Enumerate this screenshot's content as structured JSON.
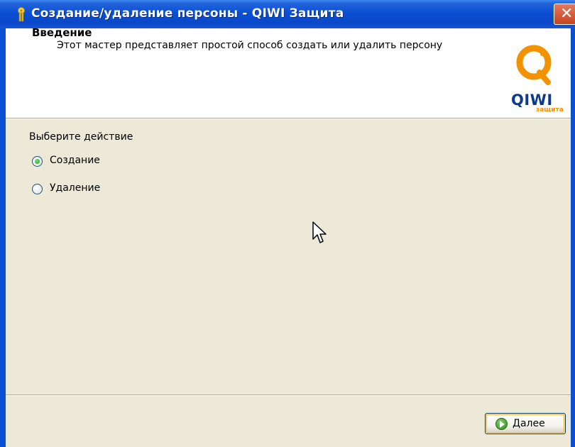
{
  "window": {
    "title": "Создание/удаление персоны - QIWI Защита",
    "close_glyph": "✕"
  },
  "header": {
    "title": "Введение",
    "subtitle": "Этот мастер представляет простой способ создать или удалить персону",
    "logo_text": "QIWI",
    "logo_sub": "защита",
    "logo_icon": "qiwi-logo-icon",
    "colors": {
      "logo_orange": "#f39200",
      "logo_blue": "#0d3a8c"
    }
  },
  "content": {
    "prompt": "Выберите действие",
    "options": [
      {
        "label": "Создание",
        "selected": true
      },
      {
        "label": "Удаление",
        "selected": false
      }
    ]
  },
  "footer": {
    "next_label": "Далее",
    "next_icon": "arrow-right-circle-icon"
  },
  "colors": {
    "titlebar": "#0b4fd4",
    "dialog_bg": "#ece9d8",
    "close_button": "#c8431e"
  }
}
